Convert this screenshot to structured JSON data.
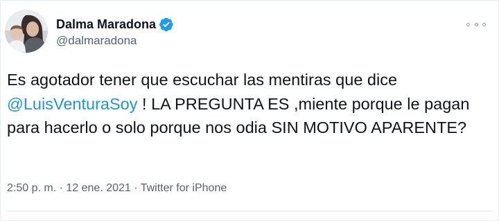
{
  "author": {
    "display_name": "Dalma Maradona",
    "handle": "@dalmaradona",
    "verified": true
  },
  "tweet": {
    "text_before": "Es agotador tener que escuchar las mentiras que dice ",
    "mention": "@LuisVenturaSoy",
    "text_after": " ! LA PREGUNTA ES ,miente porque le pagan para hacerlo o solo porque nos odia SIN MOTIVO APARENTE?"
  },
  "meta": {
    "time": "2:50 p. m.",
    "separator": " · ",
    "date": "12 ene. 2021",
    "source": "Twitter for iPhone"
  },
  "colors": {
    "mention": "#1b95e0",
    "verified_badge": "#1d9bf0",
    "secondary_text": "#536471"
  },
  "icons": {
    "verified": "verified-badge-icon",
    "more": "more-options-icon"
  }
}
